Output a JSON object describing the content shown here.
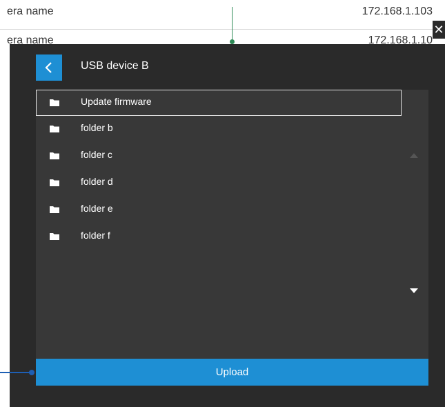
{
  "background": {
    "rows": [
      {
        "name": "era name",
        "ip": "172.168.1.103"
      },
      {
        "name": "era name",
        "ip": "172.168.1.10"
      }
    ]
  },
  "dialog": {
    "title": "USB device B",
    "back_icon": "chevron-left-icon",
    "close_icon": "close-icon",
    "items": [
      {
        "label": "Update firmware",
        "icon": "folder-icon",
        "selected": true
      },
      {
        "label": "folder b",
        "icon": "folder-icon"
      },
      {
        "label": "folder c",
        "icon": "folder-icon"
      },
      {
        "label": "folder d",
        "icon": "folder-icon"
      },
      {
        "label": "folder e",
        "icon": "folder-icon"
      },
      {
        "label": "folder f",
        "icon": "folder-icon"
      }
    ],
    "upload_label": "Upload"
  },
  "colors": {
    "accent": "#1e8fd4",
    "overlay_bg": "#2a2a2a",
    "panel_bg": "#383838"
  }
}
